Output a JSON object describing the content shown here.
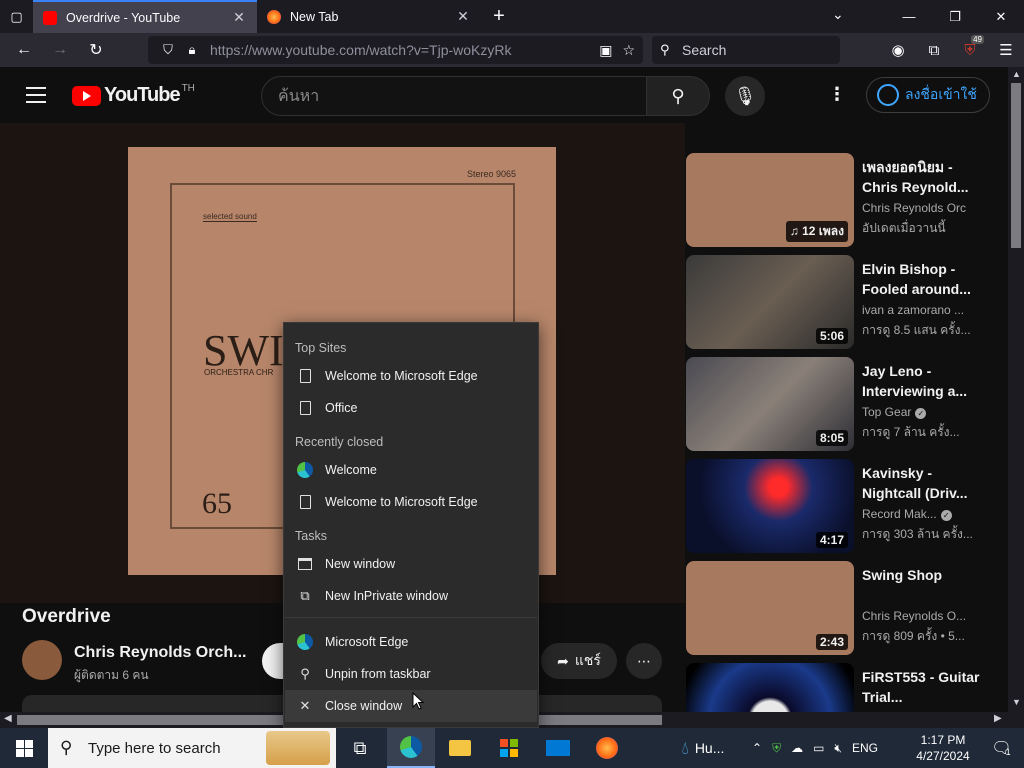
{
  "browser": {
    "tabs": [
      {
        "title": "Overdrive - YouTube",
        "active": true
      },
      {
        "title": "New Tab",
        "active": false
      }
    ],
    "url": "https://www.youtube.com/watch?v=Tjp-woKzyRk",
    "search_placeholder": "Search",
    "ublock_count": "49"
  },
  "youtube": {
    "logo_text": "YouTube",
    "country": "TH",
    "search_placeholder": "ค้นหา",
    "signin_label": "ลงชื่อเข้าใช้",
    "album": {
      "stereo": "Stereo 9065",
      "selected": "selected sound",
      "swing": "SWIN",
      "orchestra": "ORCHESTRA CHR",
      "number": "65"
    },
    "video_title": "Overdrive",
    "channel_name": "Chris Reynolds Orch...",
    "subscribers": "ผู้ติดตาม 6 คน",
    "share_label": "แชร์",
    "recommendations": [
      {
        "title": "เพลงยอดนิยม - Chris Reynold...",
        "channel": "Chris Reynolds Orc",
        "meta": "อัปเดตเมื่อวานนี้",
        "duration": "12 เพลง",
        "verified": false,
        "thumb": "swing-corner"
      },
      {
        "title": "Elvin Bishop - Fooled around...",
        "channel": "ivan a zamorano ...",
        "meta": "การดู 8.5 แสน ครั้ง...",
        "duration": "5:06",
        "verified": false,
        "thumb": "stage"
      },
      {
        "title": "Jay Leno - Interviewing a...",
        "channel": "Top Gear",
        "meta": "การดู 7 ล้าน ครั้ง...",
        "duration": "8:05",
        "verified": true,
        "thumb": "crowd"
      },
      {
        "title": "Kavinsky - Nightcall (Driv...",
        "channel": "Record Mak...",
        "meta": "การดู 303 ล้าน ครั้ง...",
        "duration": "4:17",
        "verified": true,
        "thumb": "anime"
      },
      {
        "title": "Swing Shop",
        "channel": "Chris Reynolds O...",
        "meta": "การดู 809 ครั้ง  •  5...",
        "duration": "2:43",
        "verified": false,
        "thumb": "swing-corner"
      },
      {
        "title": "FiRST553 - Guitar Trial...",
        "channel": "",
        "meta": "",
        "duration": "",
        "verified": false,
        "thumb": "logo"
      }
    ]
  },
  "jumplist": {
    "top_sites_header": "Top Sites",
    "top_sites": [
      "Welcome to Microsoft Edge",
      "Office"
    ],
    "recently_closed_header": "Recently closed",
    "recently_closed": [
      "Welcome",
      "Welcome to Microsoft Edge"
    ],
    "tasks_header": "Tasks",
    "tasks": [
      "New window",
      "New InPrivate window"
    ],
    "app_name": "Microsoft Edge",
    "unpin_label": "Unpin from taskbar",
    "close_label": "Close window"
  },
  "taskbar": {
    "search_placeholder": "Type here to search",
    "weather_label": "Hu...",
    "language": "ENG",
    "time": "1:17 PM",
    "date": "4/27/2024",
    "notification_count": "1"
  }
}
